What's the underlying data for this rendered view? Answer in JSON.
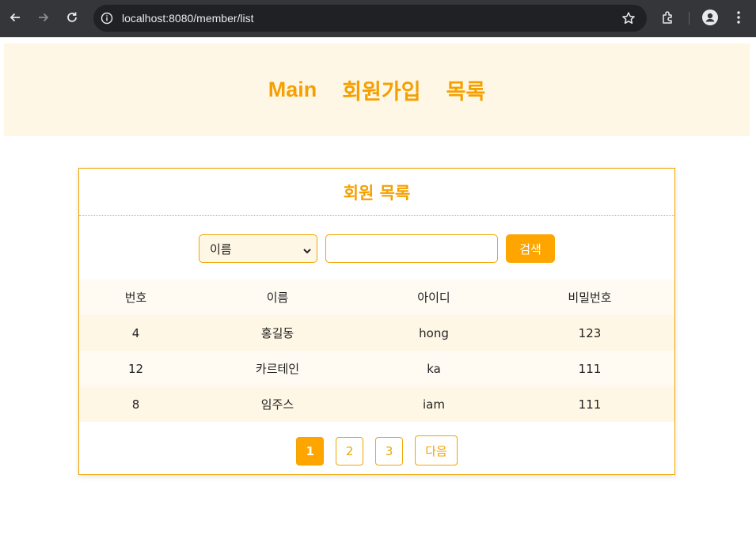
{
  "browser": {
    "url": "localhost:8080/member/list"
  },
  "header": {
    "nav": [
      {
        "label": "Main"
      },
      {
        "label": "회원가입"
      },
      {
        "label": "목록"
      }
    ]
  },
  "card": {
    "title": "회원 목록",
    "search": {
      "selected_option": "이름",
      "input_value": "",
      "button_label": "검색"
    },
    "table": {
      "headers": [
        "번호",
        "이름",
        "아이디",
        "비밀번호"
      ],
      "rows": [
        [
          "4",
          "홍길동",
          "hong",
          "123"
        ],
        [
          "12",
          "카르테인",
          "ka",
          "111"
        ],
        [
          "8",
          "임주스",
          "iam",
          "111"
        ]
      ]
    },
    "pagination": {
      "pages": [
        "1",
        "2",
        "3"
      ],
      "current": "1",
      "next_label": "다음"
    }
  },
  "colors": {
    "accent": "#ffa500",
    "header_bg": "#fff7e6",
    "chrome_bg": "#35363a"
  }
}
